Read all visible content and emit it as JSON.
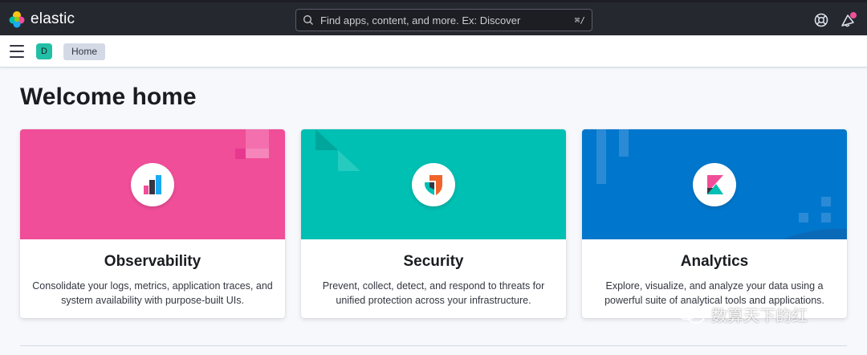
{
  "header": {
    "brand": "elastic",
    "search_placeholder": "Find apps, content, and more. Ex: Discover",
    "search_shortcut": "⌘/",
    "help_icon": "help-icon",
    "news_icon": "newsfeed-icon",
    "news_badge_color": "#f04e98"
  },
  "subheader": {
    "space_initial": "D",
    "space_color": "#21c0a6",
    "breadcrumb": "Home"
  },
  "page": {
    "title": "Welcome home"
  },
  "solutions": [
    {
      "title": "Observability",
      "description": "Consolidate your logs, metrics, application traces, and system availability with purpose-built UIs.",
      "color": "#f04e98",
      "icon": "observability-logo-icon"
    },
    {
      "title": "Security",
      "description": "Prevent, collect, detect, and respond to threats for unified protection across your infrastructure.",
      "color": "#00bfb3",
      "icon": "security-logo-icon"
    },
    {
      "title": "Analytics",
      "description": "Explore, visualize, and analyze your data using a powerful suite of analytical tools and applications.",
      "color": "#0077cc",
      "icon": "kibana-logo-icon"
    }
  ],
  "watermark": {
    "text": "数算天下的红"
  }
}
